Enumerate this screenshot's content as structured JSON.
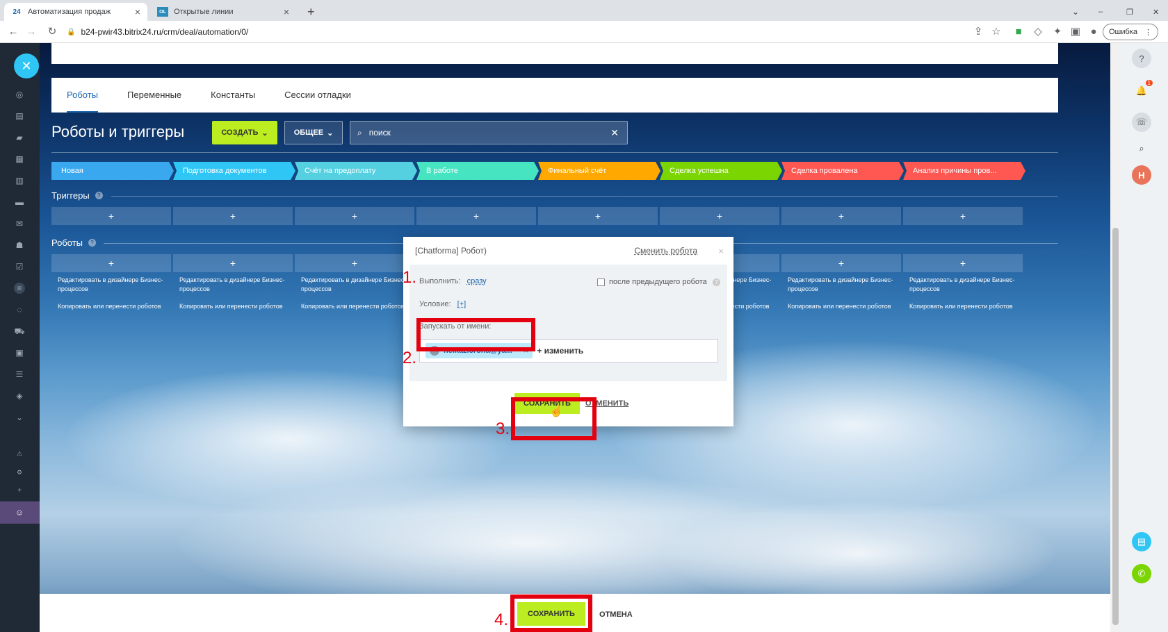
{
  "browser": {
    "tabs": [
      {
        "label": "Автоматизация продаж",
        "favicon": "24"
      },
      {
        "label": "Открытые линии",
        "favicon": "OL"
      }
    ],
    "url": "b24-pwir43.bitrix24.ru/crm/deal/automation/0/",
    "error_button": "Ошибка"
  },
  "tabs": [
    "Роботы",
    "Переменные",
    "Константы",
    "Сессии отладки"
  ],
  "page_title": "Роботы и триггеры",
  "toolbar": {
    "create": "СОЗДАТЬ",
    "common": "ОБЩЕЕ",
    "search_placeholder": "поиск"
  },
  "stages": [
    {
      "label": "Новая",
      "color": "#39a8ef"
    },
    {
      "label": "Подготовка документов",
      "color": "#2fc6f6"
    },
    {
      "label": "Счёт на предоплату",
      "color": "#55d0e0"
    },
    {
      "label": "В работе",
      "color": "#47e4c2"
    },
    {
      "label": "Финальный счёт",
      "color": "#ffa900"
    },
    {
      "label": "Сделка успешна",
      "color": "#7bd500"
    },
    {
      "label": "Сделка провалена",
      "color": "#ff5752"
    },
    {
      "label": "Анализ причины пров...",
      "color": "#ff5752"
    }
  ],
  "sections": {
    "triggers": "Триггеры",
    "robots": "Роботы"
  },
  "add_symbol": "+",
  "cell_texts": {
    "edit": "Редактировать в дизайнере Бизнес-процессов",
    "copy": "Копировать или перенести роботов"
  },
  "dialog": {
    "title": "[Chatforma] Робот)",
    "change_robot": "Сменить робота",
    "close": "×",
    "execute_label": "Выполнить:",
    "execute_value": "сразу",
    "after_previous": "после предыдущего робота",
    "condition_label": "Условие:",
    "condition_value": "[+]",
    "run_as_label": "Запускать от имени:",
    "user": "helkazicrona@ya...",
    "change": "+ изменить",
    "save": "СОХРАНИТЬ",
    "cancel": "ОТМЕНИТЬ"
  },
  "footer": {
    "save": "СОХРАНИТЬ",
    "cancel": "ОТМЕНА"
  },
  "annotations": [
    "1.",
    "2.",
    "3.",
    "4."
  ],
  "right_bar": {
    "avatar_letter": "Н",
    "notification_count": "1"
  },
  "colors": {
    "accent_green": "#bbed21",
    "link_blue": "#2067b0",
    "highlight_red": "#e3000f"
  }
}
